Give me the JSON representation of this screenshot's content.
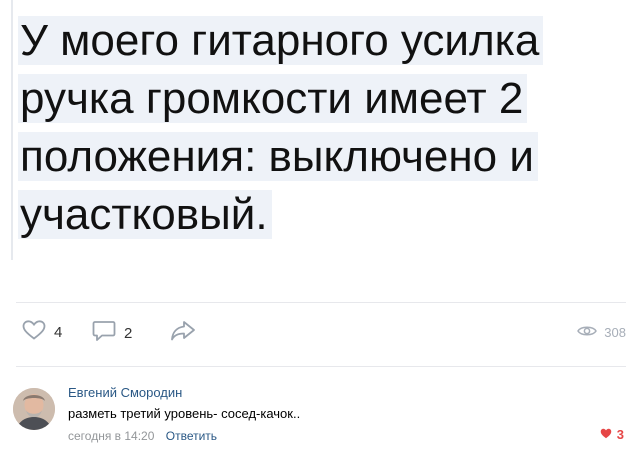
{
  "post": {
    "text_lines": [
      "У моего гитарного усилка",
      "ручка громкости имеет 2",
      "положения: выключено и",
      "участковый."
    ]
  },
  "actions": {
    "likes_count": "4",
    "comments_count": "2",
    "views_count": "308"
  },
  "comment": {
    "author": "Евгений Смородин",
    "text": "разметь третий уровень- сосед-качок..",
    "time": "сегодня в 14:20",
    "reply_label": "Ответить",
    "likes_count": "3",
    "like_color": "#e64646"
  },
  "colors": {
    "link": "#2a5885",
    "muted": "#939699",
    "highlight": "#eef2f8"
  },
  "icons": {
    "like": "heart-outline-icon",
    "comment": "comment-icon",
    "share": "share-arrow-icon",
    "views": "eye-icon",
    "comment_like": "heart-filled-icon"
  }
}
